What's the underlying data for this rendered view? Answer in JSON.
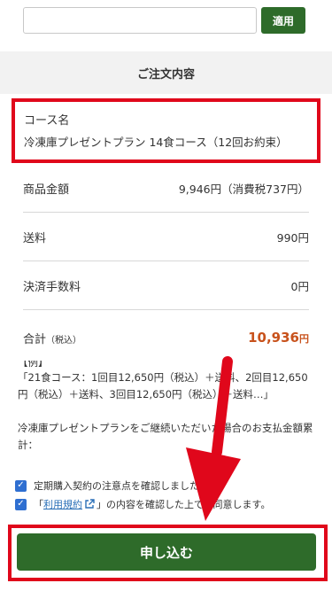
{
  "coupon": {
    "placeholder": "",
    "apply_label": "適用"
  },
  "order": {
    "section_title": "ご注文内容",
    "course_label": "コース名",
    "course_name": "冷凍庫プレゼントプラン 14食コース（12回お約束）",
    "rows": [
      {
        "label": "商品金額",
        "value": "9,946円（消費税737円）"
      },
      {
        "label": "送料",
        "value": "990円"
      },
      {
        "label": "決済手数料",
        "value": "0円"
      }
    ],
    "total": {
      "label": "合計",
      "tax_note": "（税込）",
      "amount": "10,936",
      "unit": "円"
    }
  },
  "notes": {
    "lines": [
      "【例】",
      "「21食コース：1回目12,650円（税込）＋送料、2回目12,650円（税込）＋送料、3回目12,650円（税込）＋送料…」",
      "",
      "冷凍庫プレゼントプランをご継続いただいた場合のお支払金額累計："
    ]
  },
  "checks": {
    "first": "定期購入契約の注意点を確認しました",
    "second_pre": "「",
    "second_link": "利用規約",
    "second_post": "」の内容を確認した上で、同意します。"
  },
  "submit": {
    "label": "申し込む"
  },
  "colors": {
    "brand_green": "#2e6b2a",
    "highlight_red": "#e0071b",
    "total_orange": "#c8521c",
    "checkbox_blue": "#2f6fd1"
  }
}
